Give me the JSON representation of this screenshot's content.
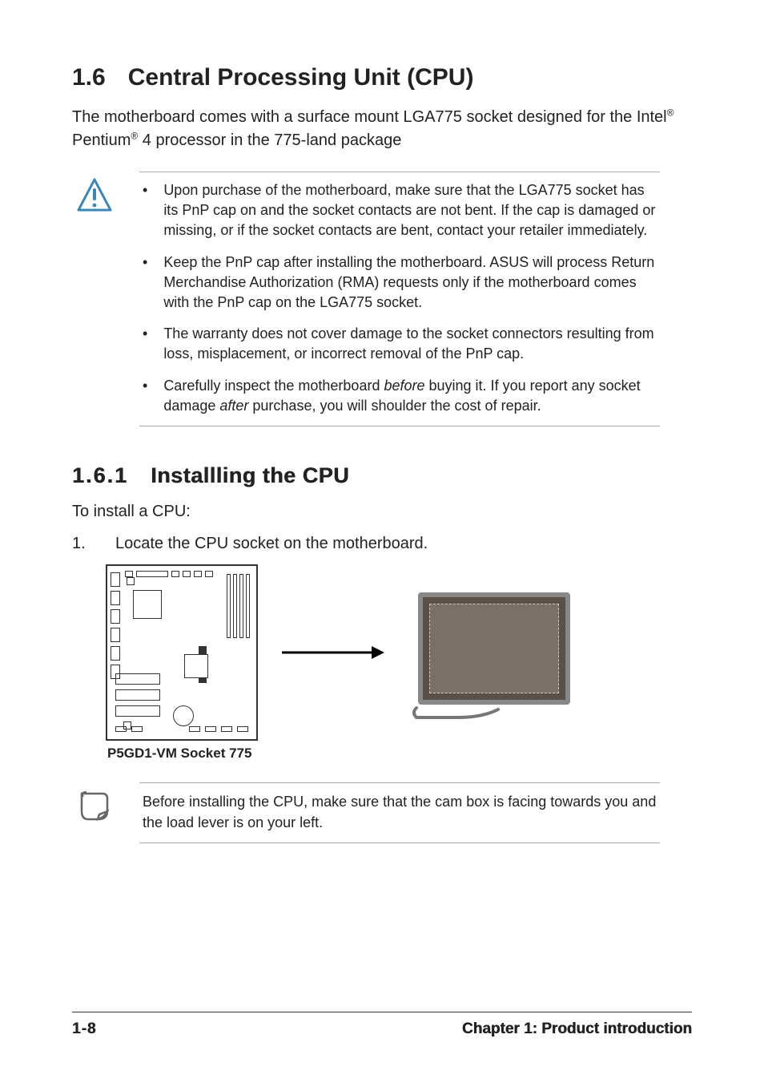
{
  "section": {
    "number": "1.6",
    "title": "Central Processing Unit (CPU)"
  },
  "intro": {
    "pre": "The motherboard comes with a surface mount LGA775 socket designed for the Intel",
    "reg1": "®",
    "mid": " Pentium",
    "reg2": "®",
    "post": " 4 processor in the 775-land package"
  },
  "warnings": [
    "Upon purchase of the motherboard, make sure that the LGA775 socket has its PnP cap on and the socket contacts are not bent. If the cap is damaged or missing, or if the socket contacts are bent, contact your retailer immediately.",
    "Keep the PnP cap after installing the motherboard. ASUS will process Return Merchandise Authorization (RMA) requests only if the motherboard comes with the PnP cap on the LGA775 socket.",
    "The warranty does not cover damage to the socket connectors resulting from loss, misplacement, or incorrect removal of the PnP cap."
  ],
  "warn4": {
    "pre": "Carefully inspect the motherboard ",
    "em1": "before",
    "mid": " buying it. If you report any socket damage ",
    "em2": "after",
    "post": " purchase, you will shoulder the cost of repair."
  },
  "subsection": {
    "number": "1.6.1",
    "title": "Installling the CPU"
  },
  "install_lead": "To install a CPU:",
  "step1": {
    "num": "1.",
    "text": "Locate the CPU socket on the motherboard."
  },
  "figure_caption": "P5GD1-VM Socket 775",
  "note": "Before installing the CPU, make sure that the cam box is facing towards you and the load lever is on your left.",
  "footer": {
    "page": "1-8",
    "chapter": "Chapter 1: Product introduction"
  }
}
